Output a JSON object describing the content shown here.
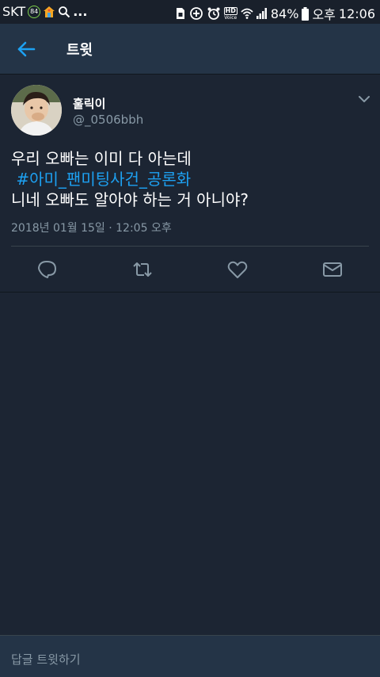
{
  "status_bar": {
    "carrier": "SKT",
    "badge": "84",
    "ellipsis": "...",
    "hd_label": "HD",
    "voice_label": "Voice",
    "battery": "84%",
    "ampm": "오후",
    "time": "12:06"
  },
  "header": {
    "title": "트윗"
  },
  "tweet": {
    "author_name": "훌릭이",
    "author_handle": "@_0506bbh",
    "text_line1": "우리 오빠는 이미 다 아는데",
    "hashtag": "#아미_팬미팅사건_공론화",
    "text_line3": "니네 오빠도 알아야 하는 거 아니야?",
    "timestamp": "2018년 01월 15일 · 12:05 오후"
  },
  "reply": {
    "placeholder": "답글 트윗하기"
  },
  "colors": {
    "background": "#1c2533",
    "bar": "#243447",
    "accent": "#1da1f2",
    "muted": "#8899a6"
  },
  "icons": [
    "back-arrow-icon",
    "chevron-down-icon",
    "reply-icon",
    "retweet-icon",
    "like-icon",
    "message-icon"
  ]
}
